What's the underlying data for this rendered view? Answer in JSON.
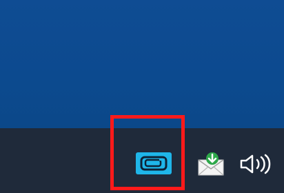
{
  "screen": {
    "desktop_color": "#0f4c93",
    "taskbar_color": "#1f2a3a",
    "highlight_color": "#ff1a1a"
  },
  "tray": {
    "icons": [
      {
        "name": "app-tray-icon",
        "accent": "#1fb6e9"
      },
      {
        "name": "mail-download-icon",
        "accent": "#2ea84a"
      },
      {
        "name": "speaker-volume-icon",
        "accent": "#ffffff"
      }
    ]
  }
}
